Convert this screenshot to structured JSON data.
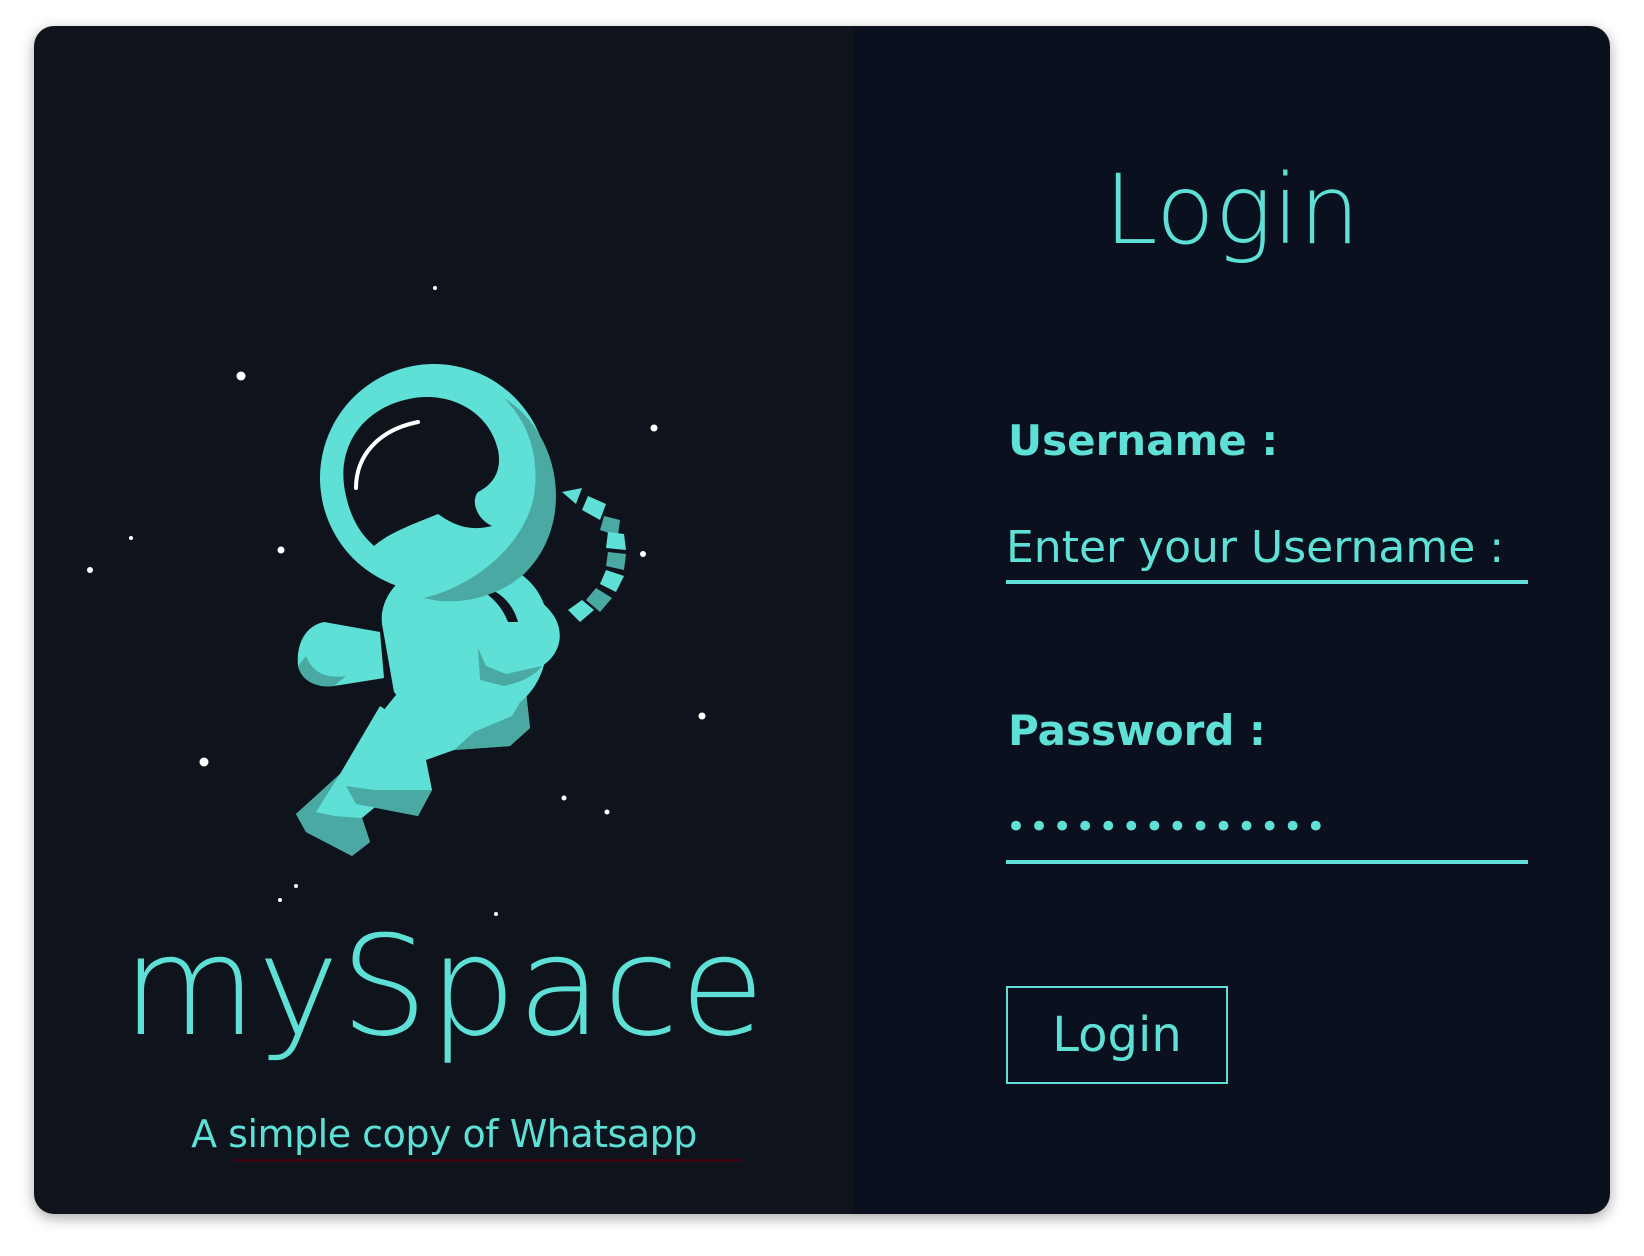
{
  "brand": {
    "name": "mySpace",
    "tagline": "A simple copy of Whatsapp"
  },
  "login_form": {
    "title": "Login",
    "username_label": "Username :",
    "username_placeholder": "Enter your Username :",
    "username_value": "",
    "password_label": "Password :",
    "password_value": "passwordpasswd",
    "submit_label": "Login"
  },
  "colors": {
    "accent": "#5fe0d6",
    "accent_shadow": "#4aa9a3",
    "left_panel_bg": "#0f141c",
    "right_panel_bg": "#0a101d",
    "tagline_underline": "#3a0710"
  },
  "icons": {
    "illustration": "astronaut-illustration"
  }
}
